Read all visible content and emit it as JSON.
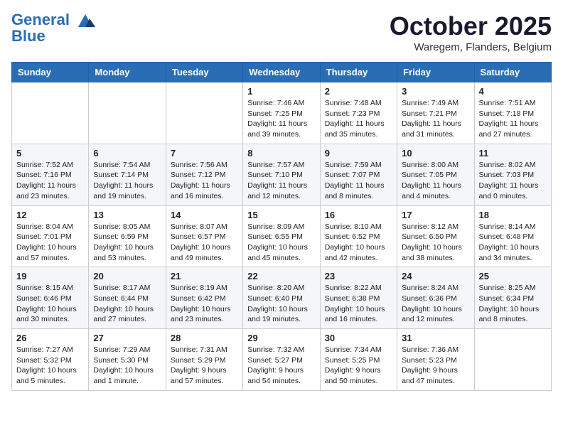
{
  "header": {
    "logo_line1": "General",
    "logo_line2": "Blue",
    "month": "October 2025",
    "location": "Waregem, Flanders, Belgium"
  },
  "weekdays": [
    "Sunday",
    "Monday",
    "Tuesday",
    "Wednesday",
    "Thursday",
    "Friday",
    "Saturday"
  ],
  "weeks": [
    [
      {
        "day": "",
        "info": ""
      },
      {
        "day": "",
        "info": ""
      },
      {
        "day": "",
        "info": ""
      },
      {
        "day": "1",
        "info": "Sunrise: 7:46 AM\nSunset: 7:25 PM\nDaylight: 11 hours\nand 39 minutes."
      },
      {
        "day": "2",
        "info": "Sunrise: 7:48 AM\nSunset: 7:23 PM\nDaylight: 11 hours\nand 35 minutes."
      },
      {
        "day": "3",
        "info": "Sunrise: 7:49 AM\nSunset: 7:21 PM\nDaylight: 11 hours\nand 31 minutes."
      },
      {
        "day": "4",
        "info": "Sunrise: 7:51 AM\nSunset: 7:18 PM\nDaylight: 11 hours\nand 27 minutes."
      }
    ],
    [
      {
        "day": "5",
        "info": "Sunrise: 7:52 AM\nSunset: 7:16 PM\nDaylight: 11 hours\nand 23 minutes."
      },
      {
        "day": "6",
        "info": "Sunrise: 7:54 AM\nSunset: 7:14 PM\nDaylight: 11 hours\nand 19 minutes."
      },
      {
        "day": "7",
        "info": "Sunrise: 7:56 AM\nSunset: 7:12 PM\nDaylight: 11 hours\nand 16 minutes."
      },
      {
        "day": "8",
        "info": "Sunrise: 7:57 AM\nSunset: 7:10 PM\nDaylight: 11 hours\nand 12 minutes."
      },
      {
        "day": "9",
        "info": "Sunrise: 7:59 AM\nSunset: 7:07 PM\nDaylight: 11 hours\nand 8 minutes."
      },
      {
        "day": "10",
        "info": "Sunrise: 8:00 AM\nSunset: 7:05 PM\nDaylight: 11 hours\nand 4 minutes."
      },
      {
        "day": "11",
        "info": "Sunrise: 8:02 AM\nSunset: 7:03 PM\nDaylight: 11 hours\nand 0 minutes."
      }
    ],
    [
      {
        "day": "12",
        "info": "Sunrise: 8:04 AM\nSunset: 7:01 PM\nDaylight: 10 hours\nand 57 minutes."
      },
      {
        "day": "13",
        "info": "Sunrise: 8:05 AM\nSunset: 6:59 PM\nDaylight: 10 hours\nand 53 minutes."
      },
      {
        "day": "14",
        "info": "Sunrise: 8:07 AM\nSunset: 6:57 PM\nDaylight: 10 hours\nand 49 minutes."
      },
      {
        "day": "15",
        "info": "Sunrise: 8:09 AM\nSunset: 6:55 PM\nDaylight: 10 hours\nand 45 minutes."
      },
      {
        "day": "16",
        "info": "Sunrise: 8:10 AM\nSunset: 6:52 PM\nDaylight: 10 hours\nand 42 minutes."
      },
      {
        "day": "17",
        "info": "Sunrise: 8:12 AM\nSunset: 6:50 PM\nDaylight: 10 hours\nand 38 minutes."
      },
      {
        "day": "18",
        "info": "Sunrise: 8:14 AM\nSunset: 6:48 PM\nDaylight: 10 hours\nand 34 minutes."
      }
    ],
    [
      {
        "day": "19",
        "info": "Sunrise: 8:15 AM\nSunset: 6:46 PM\nDaylight: 10 hours\nand 30 minutes."
      },
      {
        "day": "20",
        "info": "Sunrise: 8:17 AM\nSunset: 6:44 PM\nDaylight: 10 hours\nand 27 minutes."
      },
      {
        "day": "21",
        "info": "Sunrise: 8:19 AM\nSunset: 6:42 PM\nDaylight: 10 hours\nand 23 minutes."
      },
      {
        "day": "22",
        "info": "Sunrise: 8:20 AM\nSunset: 6:40 PM\nDaylight: 10 hours\nand 19 minutes."
      },
      {
        "day": "23",
        "info": "Sunrise: 8:22 AM\nSunset: 6:38 PM\nDaylight: 10 hours\nand 16 minutes."
      },
      {
        "day": "24",
        "info": "Sunrise: 8:24 AM\nSunset: 6:36 PM\nDaylight: 10 hours\nand 12 minutes."
      },
      {
        "day": "25",
        "info": "Sunrise: 8:25 AM\nSunset: 6:34 PM\nDaylight: 10 hours\nand 8 minutes."
      }
    ],
    [
      {
        "day": "26",
        "info": "Sunrise: 7:27 AM\nSunset: 5:32 PM\nDaylight: 10 hours\nand 5 minutes."
      },
      {
        "day": "27",
        "info": "Sunrise: 7:29 AM\nSunset: 5:30 PM\nDaylight: 10 hours\nand 1 minute."
      },
      {
        "day": "28",
        "info": "Sunrise: 7:31 AM\nSunset: 5:29 PM\nDaylight: 9 hours\nand 57 minutes."
      },
      {
        "day": "29",
        "info": "Sunrise: 7:32 AM\nSunset: 5:27 PM\nDaylight: 9 hours\nand 54 minutes."
      },
      {
        "day": "30",
        "info": "Sunrise: 7:34 AM\nSunset: 5:25 PM\nDaylight: 9 hours\nand 50 minutes."
      },
      {
        "day": "31",
        "info": "Sunrise: 7:36 AM\nSunset: 5:23 PM\nDaylight: 9 hours\nand 47 minutes."
      },
      {
        "day": "",
        "info": ""
      }
    ]
  ]
}
